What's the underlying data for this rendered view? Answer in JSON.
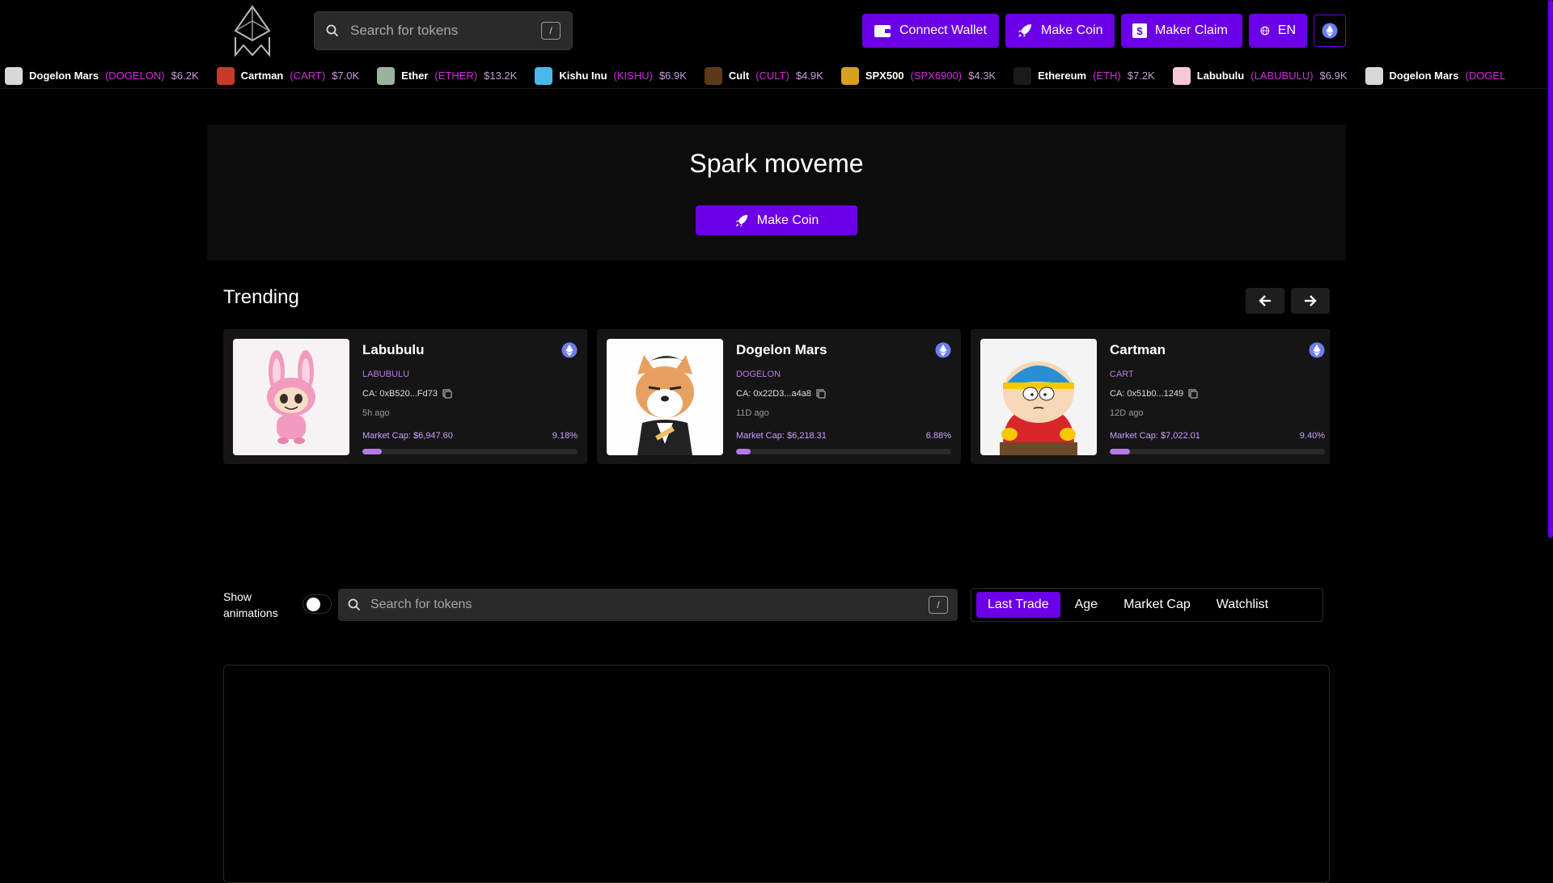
{
  "header": {
    "search_placeholder": "Search for tokens",
    "search_shortcut": "/",
    "buttons": {
      "connect_wallet": "Connect Wallet",
      "make_coin": "Make Coin",
      "maker_claim": "Maker Claim",
      "language": "EN"
    }
  },
  "ticker": [
    {
      "name": "Dogelon Mars",
      "symbol": "(DOGELON)",
      "price": "$6.2K",
      "color": "#d8d8d8"
    },
    {
      "name": "Cartman",
      "symbol": "(CART)",
      "price": "$7.0K",
      "color": "#c83a2a"
    },
    {
      "name": "Ether",
      "symbol": "(ETHER)",
      "price": "$13.2K",
      "color": "#9bb39b"
    },
    {
      "name": "Kishu Inu",
      "symbol": "(KISHU)",
      "price": "$6.9K",
      "color": "#4ab8e8"
    },
    {
      "name": "Cult",
      "symbol": "(CULT)",
      "price": "$4.9K",
      "color": "#5a3a1a"
    },
    {
      "name": "SPX500",
      "symbol": "(SPX6900)",
      "price": "$4.3K",
      "color": "#d8a020"
    },
    {
      "name": "Ethereum",
      "symbol": "(ETH)",
      "price": "$7.2K",
      "color": "#1a1a1a"
    },
    {
      "name": "Labubulu",
      "symbol": "(LABUBULU)",
      "price": "$6.9K",
      "color": "#f4c8d8"
    },
    {
      "name": "Dogelon Mars",
      "symbol": "(DOGEL",
      "price": "",
      "color": "#d8d8d8"
    }
  ],
  "hero": {
    "title": "Spark moveme",
    "button": "Make Coin"
  },
  "trending": {
    "title": "Trending",
    "cards": [
      {
        "name": "Labubulu",
        "symbol": "LABUBULU",
        "ca": "CA: 0xB520...Fd73",
        "age": "5h ago",
        "market_cap": "Market Cap: $6,947.60",
        "percent": "9.18%",
        "progress": 0.0918
      },
      {
        "name": "Dogelon Mars",
        "symbol": "DOGELON",
        "ca": "CA: 0x22D3...a4a8",
        "age": "11D ago",
        "market_cap": "Market Cap: $6,218.31",
        "percent": "6.88%",
        "progress": 0.0688
      },
      {
        "name": "Cartman",
        "symbol": "CART",
        "ca": "CA: 0x51b0...1249",
        "age": "12D ago",
        "market_cap": "Market Cap: $7,022.01",
        "percent": "9.40%",
        "progress": 0.094
      }
    ]
  },
  "filters": {
    "show_animations": "Show animations",
    "search_placeholder": "Search for tokens",
    "search_shortcut": "/",
    "tabs": [
      "Last Trade",
      "Age",
      "Market Cap",
      "Watchlist"
    ],
    "active_tab": "Last Trade"
  },
  "colors": {
    "accent": "#6b00e6",
    "symbol_pink": "#d12ce0",
    "progress": "#b57ae6"
  }
}
